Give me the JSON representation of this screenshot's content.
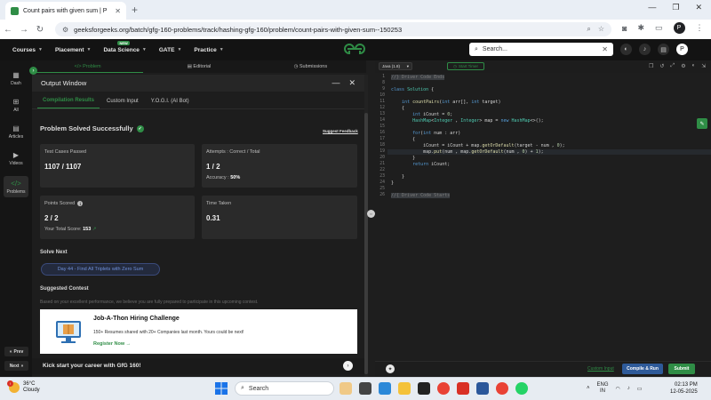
{
  "browser": {
    "tab_title": "Count pairs with given sum | P",
    "url": "geeksforgeeks.org/batch/gfg-160-problems/track/hashing-gfg-160/problem/count-pairs-with-given-sum--150253"
  },
  "header": {
    "menu": [
      {
        "label": "Courses"
      },
      {
        "label": "Placement"
      },
      {
        "label": "Data Science",
        "badge": "NEW"
      },
      {
        "label": "GATE"
      },
      {
        "label": "Practice"
      }
    ],
    "search_placeholder": "Search...",
    "avatar_letter": "P"
  },
  "rail": {
    "items": [
      "Dash",
      "All",
      "Articles",
      "Videos",
      "Problems"
    ],
    "prev": "Prev",
    "next": "Next"
  },
  "problem_tabs": [
    "Problem",
    "Editorial",
    "Submissions"
  ],
  "output": {
    "title": "Output Window",
    "tabs": [
      "Compilation Results",
      "Custom Input",
      "Y.O.G.I. (AI Bot)"
    ],
    "status": "Problem Solved Successfully",
    "feedback": "Suggest Feedback",
    "cards": {
      "tests_label": "Test Cases Passed",
      "tests_value": "1107 / 1107",
      "attempts_label": "Attempts : Correct / Total",
      "attempts_value": "1 / 2",
      "accuracy_label": "Accuracy :",
      "accuracy_value": "50%",
      "points_label": "Points Scored",
      "points_value": "2 / 2",
      "total_label": "Your Total Score:",
      "total_value": "153",
      "time_label": "Time Taken",
      "time_value": "0.31"
    },
    "solve_next": "Solve Next",
    "next_problem": "Day 44 - Find All Triplets with Zero Sum",
    "suggested": "Suggested Contest",
    "suggested_desc": "Based on your excellent performance, we believe you are fully prepared to participate in this upcoming contest.",
    "banner_title": "Job-A-Thon Hiring Challenge",
    "banner_sub": "150+ Resumes shared with 20+ Companies last month. Yours could be next!",
    "banner_link": "Register Now →",
    "kick": "Kick start your career with GfG 160!"
  },
  "editor": {
    "language": "Java (1.8)",
    "timer": "Start Timer",
    "custom_input": "Custom Input",
    "compile": "Compile & Run",
    "submit": "Submit",
    "line_numbers": [
      "1",
      "8",
      "9",
      "10",
      "11",
      "12",
      "13",
      "14",
      "15",
      "16",
      "17",
      "18",
      "19",
      "20",
      "21",
      "22",
      "23",
      "24",
      "25",
      "26"
    ]
  },
  "taskbar": {
    "temp": "36°C",
    "weather": "Cloudy",
    "search": "Search",
    "lang1": "ENG",
    "lang2": "IN",
    "time": "02:13 PM",
    "date": "12-05-2025"
  }
}
